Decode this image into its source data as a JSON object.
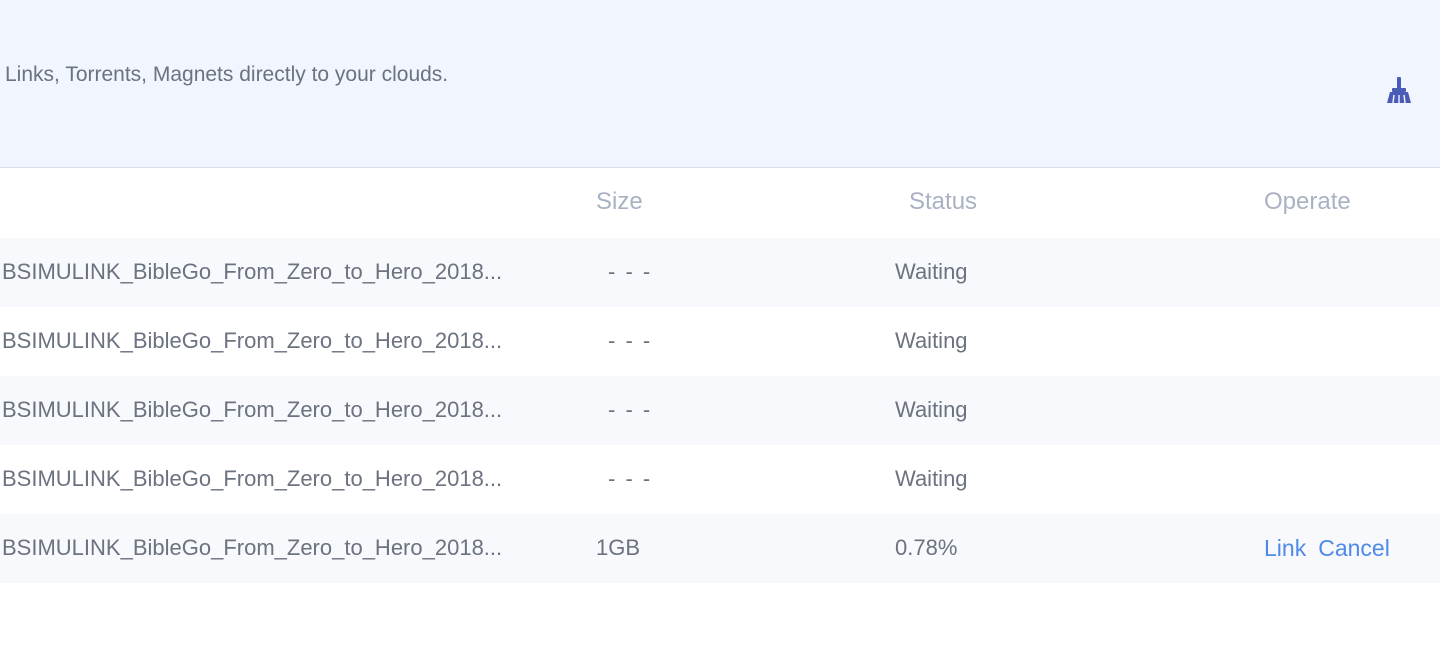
{
  "banner": {
    "text": "Links, Torrents, Magnets directly to your clouds.",
    "clear_icon": "broom-icon",
    "clear_icon_color": "#4a5cb8"
  },
  "table": {
    "headers": {
      "size": "Size",
      "status": "Status",
      "operate": "Operate"
    },
    "rows": [
      {
        "name": "BSIMULINK_BibleGo_From_Zero_to_Hero_2018...",
        "size": "- - -",
        "status": "Waiting",
        "ops": []
      },
      {
        "name": "BSIMULINK_BibleGo_From_Zero_to_Hero_2018...",
        "size": "- - -",
        "status": "Waiting",
        "ops": []
      },
      {
        "name": "BSIMULINK_BibleGo_From_Zero_to_Hero_2018...",
        "size": "- - -",
        "status": "Waiting",
        "ops": []
      },
      {
        "name": "BSIMULINK_BibleGo_From_Zero_to_Hero_2018...",
        "size": "- - -",
        "status": "Waiting",
        "ops": []
      },
      {
        "name": "BSIMULINK_BibleGo_From_Zero_to_Hero_2018...",
        "size": "1GB",
        "status": "0.78%",
        "ops": [
          "Link",
          "Cancel"
        ]
      }
    ]
  },
  "colors": {
    "accent": "#4f8ae8",
    "banner_bg": "#f1f5fd",
    "row_alt_bg": "#f7f9fc",
    "text": "#6b7280",
    "header_text": "#a9b2c3"
  }
}
